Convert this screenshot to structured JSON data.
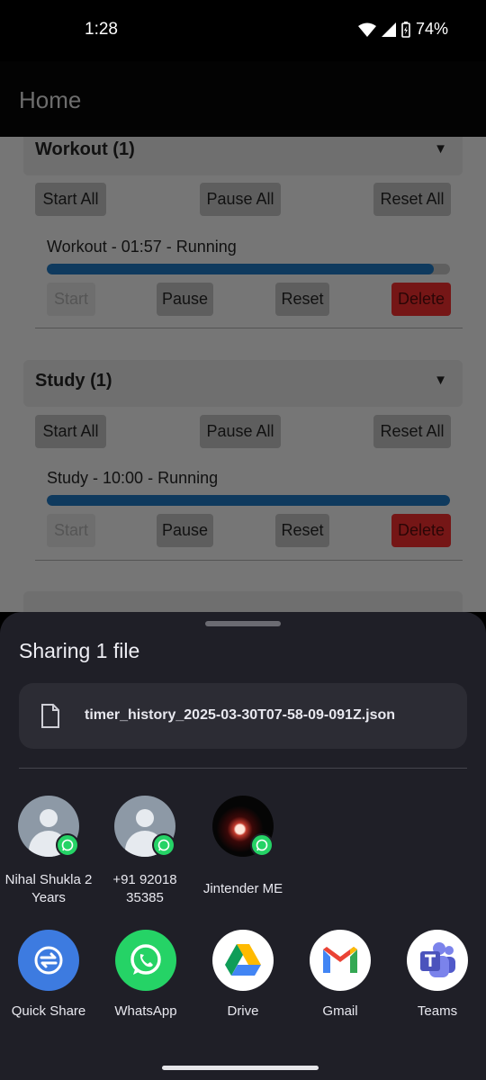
{
  "status_bar": {
    "time": "1:28",
    "battery": "74%"
  },
  "app_bar": {
    "title": "Home"
  },
  "groups": [
    {
      "title": "Workout (1)",
      "start_all": "Start All",
      "pause_all": "Pause All",
      "reset_all": "Reset All",
      "timer": {
        "label": "Workout  - 01:57 - Running",
        "progress": 0.96,
        "start": "Start",
        "pause": "Pause",
        "reset": "Reset",
        "delete": "Delete"
      }
    },
    {
      "title": "Study (1)",
      "start_all": "Start All",
      "pause_all": "Pause All",
      "reset_all": "Reset All",
      "timer": {
        "label": "Study  - 10:00 - Running",
        "progress": 1.0,
        "start": "Start",
        "pause": "Pause",
        "reset": "Reset",
        "delete": "Delete"
      }
    }
  ],
  "share_sheet": {
    "title": "Sharing 1 file",
    "file_name": "timer_history_2025-03-30T07-58-09-091Z.json",
    "contacts": [
      {
        "name": "Nihal Shukla 2 Years",
        "app": "whatsapp-icon"
      },
      {
        "name": "+91 92018 35385",
        "app": "whatsapp-icon"
      },
      {
        "name": "Jintender ME",
        "app": "whatsapp-icon"
      }
    ],
    "apps": [
      {
        "label": "Quick Share",
        "icon": "quick-share-icon",
        "color": "#3d7be0"
      },
      {
        "label": "WhatsApp",
        "icon": "whatsapp-icon",
        "color": "#25d366"
      },
      {
        "label": "Drive",
        "icon": "drive-icon",
        "color": "#ffffff"
      },
      {
        "label": "Gmail",
        "icon": "gmail-icon",
        "color": "#ffffff"
      },
      {
        "label": "Teams",
        "icon": "teams-icon",
        "color": "#ffffff"
      }
    ]
  },
  "colors": {
    "delete": "#751616",
    "progress": "#0f3a5e",
    "sheet": "#1f1f27"
  }
}
